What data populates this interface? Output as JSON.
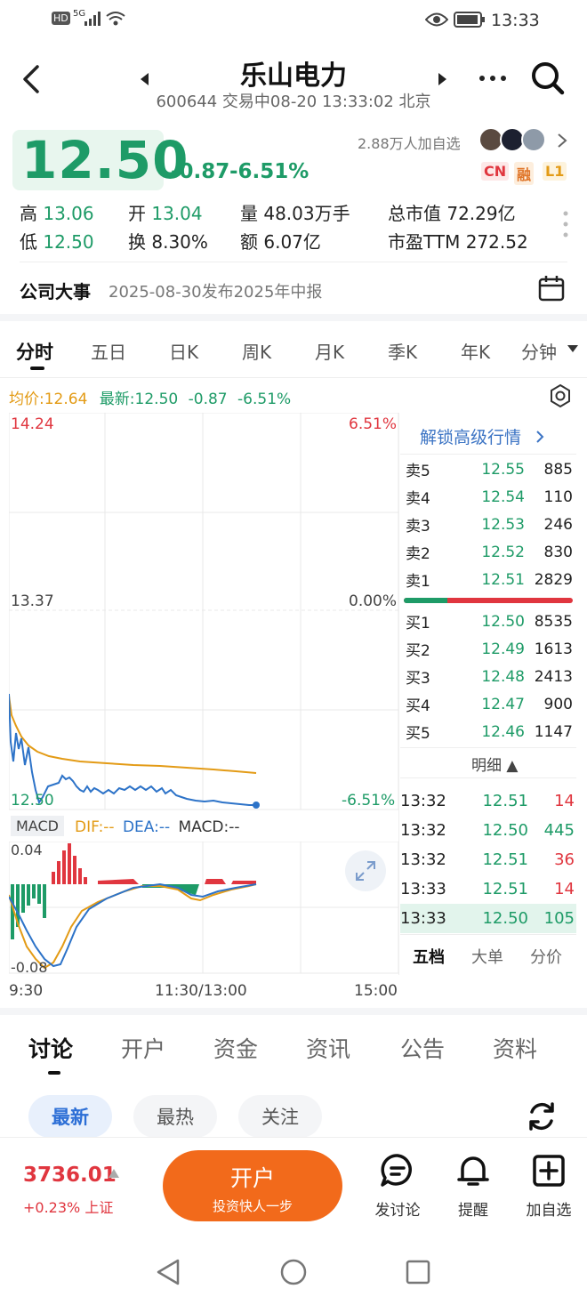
{
  "status_bar": {
    "hd": "HD",
    "network": "5G",
    "time": "13:33"
  },
  "header": {
    "title": "乐山电力",
    "subtitle": "600644 交易中08-20 13:33:02 北京"
  },
  "quote": {
    "price": "12.50",
    "change": "-0.87",
    "change_pct": "-6.51%",
    "watchers": "2.88万人加自选",
    "badges": [
      "CN",
      "融",
      "L1"
    ],
    "stats": [
      {
        "label": "高",
        "value": "13.06"
      },
      {
        "label": "开",
        "value": "13.04"
      },
      {
        "label": "量",
        "value": "48.03万手"
      },
      {
        "label": "总市值",
        "value": "72.29亿"
      },
      {
        "label": "低",
        "value": "12.50"
      },
      {
        "label": "换",
        "value": "8.30%"
      },
      {
        "label": "额",
        "value": "6.07亿"
      },
      {
        "label": "市盈TTM",
        "value": "272.52"
      }
    ]
  },
  "event": {
    "label": "公司大事",
    "text": "2025-08-30发布2025年中报"
  },
  "chart_tabs": [
    "分时",
    "五日",
    "日K",
    "周K",
    "月K",
    "季K",
    "年K",
    "分钟"
  ],
  "chart_info": {
    "avg": "均价:12.64",
    "latest": "最新:12.50",
    "change": "-0.87",
    "change_pct": "-6.51%"
  },
  "chart_axis": {
    "y_top": "14.24",
    "y_mid": "13.37",
    "y_bottom": "12.50",
    "pct_top": "6.51%",
    "pct_mid": "0.00%",
    "pct_bottom": "-6.51%",
    "x_labels": [
      "9:30",
      "11:30/13:00",
      "15:00"
    ]
  },
  "macd": {
    "label": "MACD",
    "dif": "DIF:--",
    "dea": "DEA:--",
    "macd": "MACD:--",
    "top": "0.04",
    "bottom": "-0.08"
  },
  "orderbook": {
    "unlock": "解锁高级行情",
    "asks": [
      {
        "label": "卖5",
        "price": "12.55",
        "vol": "885"
      },
      {
        "label": "卖4",
        "price": "12.54",
        "vol": "110"
      },
      {
        "label": "卖3",
        "price": "12.53",
        "vol": "246"
      },
      {
        "label": "卖2",
        "price": "12.52",
        "vol": "830"
      },
      {
        "label": "卖1",
        "price": "12.51",
        "vol": "2829"
      }
    ],
    "bids": [
      {
        "label": "买1",
        "price": "12.50",
        "vol": "8535"
      },
      {
        "label": "买2",
        "price": "12.49",
        "vol": "1613"
      },
      {
        "label": "买3",
        "price": "12.48",
        "vol": "2413"
      },
      {
        "label": "买4",
        "price": "12.47",
        "vol": "900"
      },
      {
        "label": "买5",
        "price": "12.46",
        "vol": "1147"
      }
    ],
    "detail_label": "明细 ▲",
    "ticks": [
      {
        "time": "13:32",
        "price": "12.51",
        "vol": "14"
      },
      {
        "time": "13:32",
        "price": "12.50",
        "vol": "445"
      },
      {
        "time": "13:32",
        "price": "12.51",
        "vol": "36"
      },
      {
        "time": "13:33",
        "price": "12.51",
        "vol": "14"
      },
      {
        "time": "13:33",
        "price": "12.50",
        "vol": "105"
      }
    ],
    "tabs": [
      "五档",
      "大单",
      "分价"
    ]
  },
  "discussion": {
    "tabs": [
      "讨论",
      "开户",
      "资金",
      "资讯",
      "公告",
      "资料"
    ],
    "filters": [
      "最新",
      "最热",
      "关注"
    ]
  },
  "bottom": {
    "index_value": "3736.01",
    "index_change": "+0.23% 上证",
    "open_btn": "开户",
    "open_sub": "投资快人一步",
    "actions": [
      "发讨论",
      "提醒",
      "加自选"
    ]
  },
  "colors": {
    "up": "#e0363f",
    "down": "#1e9b67",
    "accent": "#f26a1b",
    "avg_line": "#e39b16",
    "price_line": "#2d73c8"
  }
}
